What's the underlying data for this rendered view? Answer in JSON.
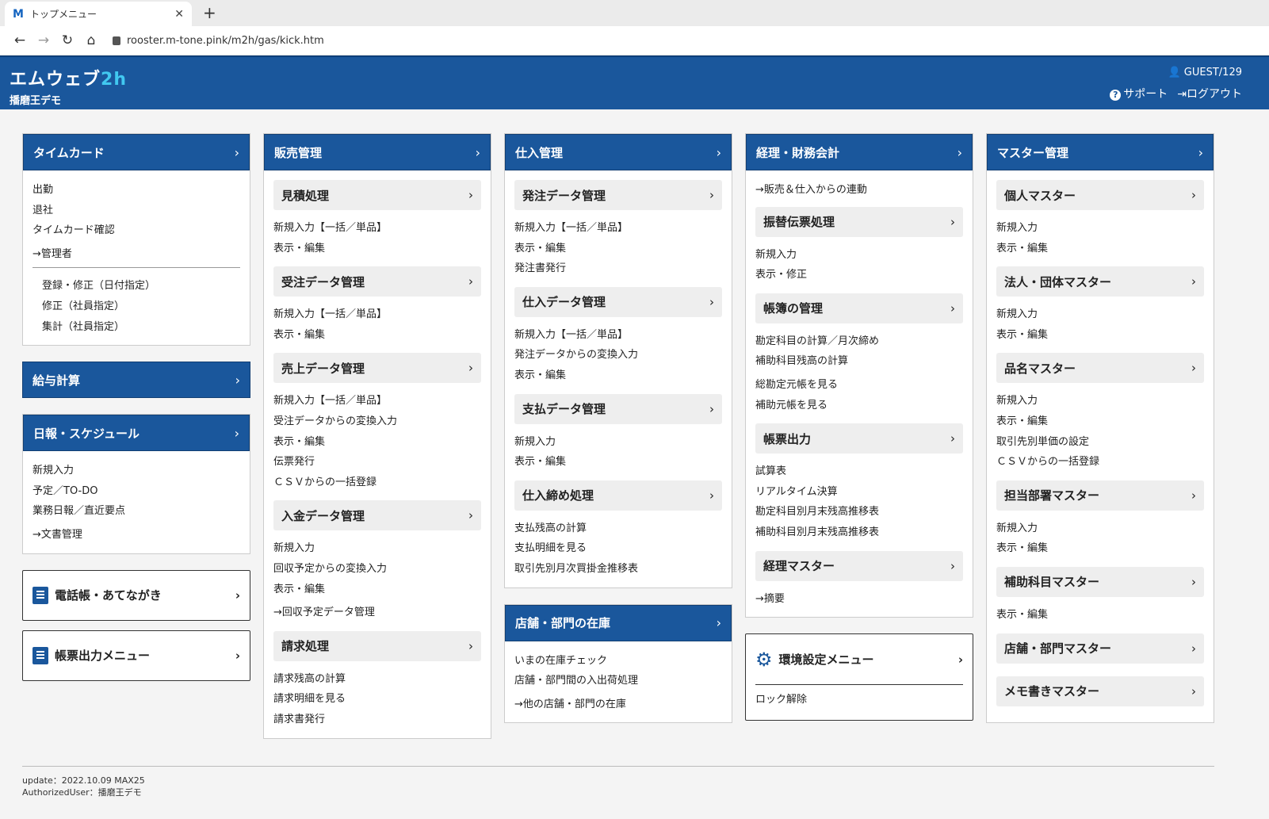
{
  "browser": {
    "tab_title": "トップメニュー",
    "favicon": "M",
    "url": "rooster.m-tone.pink/m2h/gas/kick.htm"
  },
  "header": {
    "brand_main": "エムウェブ",
    "brand_accent": "2h",
    "brand_sub": "播磨王デモ",
    "user": "GUEST/129",
    "support": "サポート",
    "logout": "ログアウト"
  },
  "timecard": {
    "title": "タイムカード",
    "items": [
      "出勤",
      "退社",
      "タイムカード確認"
    ],
    "admin": "→管理者",
    "admin_items": [
      "登録・修正（日付指定）",
      "修正（社員指定）",
      "集計（社員指定）"
    ]
  },
  "payroll": {
    "title": "給与計算"
  },
  "schedule": {
    "title": "日報・スケジュール",
    "items": [
      "新規入力",
      "予定／TO-DO",
      "業務日報／直近要点"
    ],
    "docs": "→文書管理"
  },
  "phonebook": {
    "title": "電話帳・あてながき"
  },
  "forms_menu": {
    "title": "帳票出力メニュー"
  },
  "sales": {
    "title": "販売管理",
    "estimate": {
      "title": "見積処理",
      "items": [
        "新規入力【一括／単品】",
        "表示・編集"
      ]
    },
    "orders": {
      "title": "受注データ管理",
      "items": [
        "新規入力【一括／単品】",
        "表示・編集"
      ]
    },
    "sales_data": {
      "title": "売上データ管理",
      "items": [
        "新規入力【一括／単品】",
        "受注データからの変換入力",
        "表示・編集",
        "伝票発行",
        "ＣＳＶからの一括登録"
      ]
    },
    "payment_in": {
      "title": "入金データ管理",
      "items": [
        "新規入力",
        "回収予定からの変換入力",
        "表示・編集"
      ],
      "link": "→回収予定データ管理"
    },
    "billing": {
      "title": "請求処理",
      "items": [
        "請求残高の計算",
        "請求明細を見る",
        "請求書発行"
      ]
    }
  },
  "purchase": {
    "title": "仕入管理",
    "order_data": {
      "title": "発注データ管理",
      "items": [
        "新規入力【一括／単品】",
        "表示・編集",
        "発注書発行"
      ]
    },
    "purchase_data": {
      "title": "仕入データ管理",
      "items": [
        "新規入力【一括／単品】",
        "発注データからの変換入力",
        "表示・編集"
      ]
    },
    "payment_data": {
      "title": "支払データ管理",
      "items": [
        "新規入力",
        "表示・編集"
      ]
    },
    "closing": {
      "title": "仕入締め処理",
      "items": [
        "支払残高の計算",
        "支払明細を見る",
        "取引先別月次買掛金推移表"
      ]
    }
  },
  "inventory": {
    "title": "店舗・部門の在庫",
    "items": [
      "いまの在庫チェック",
      "店舗・部門間の入出荷処理"
    ],
    "link": "→他の店舗・部門の在庫"
  },
  "accounting": {
    "title": "経理・財務会計",
    "link_top": "→販売＆仕入からの連動",
    "transfer": {
      "title": "振替伝票処理",
      "items": [
        "新規入力",
        "表示・修正"
      ]
    },
    "books": {
      "title": "帳簿の管理",
      "items": [
        "勘定科目の計算／月次締め",
        "補助科目残高の計算"
      ],
      "items2": [
        "総勘定元帳を見る",
        "補助元帳を見る"
      ]
    },
    "reports": {
      "title": "帳票出力",
      "items": [
        "試算表",
        "リアルタイム決算",
        "勘定科目別月末残高推移表",
        "補助科目別月末残高推移表"
      ]
    },
    "master": {
      "title": "経理マスター",
      "link": "→摘要"
    }
  },
  "env": {
    "title": "環境設定メニュー",
    "items": [
      "ロック解除"
    ]
  },
  "master": {
    "title": "マスター管理",
    "personal": {
      "title": "個人マスター",
      "items": [
        "新規入力",
        "表示・編集"
      ]
    },
    "corporate": {
      "title": "法人・団体マスター",
      "items": [
        "新規入力",
        "表示・編集"
      ]
    },
    "product": {
      "title": "品名マスター",
      "items": [
        "新規入力",
        "表示・編集",
        "取引先別単価の設定",
        "ＣＳＶからの一括登録"
      ]
    },
    "dept": {
      "title": "担当部署マスター",
      "items": [
        "新規入力",
        "表示・編集"
      ]
    },
    "subaccount": {
      "title": "補助科目マスター",
      "items": [
        "表示・編集"
      ]
    },
    "store": {
      "title": "店舗・部門マスター"
    },
    "memo": {
      "title": "メモ書きマスター"
    }
  },
  "footer": {
    "update": "update：2022.10.09 MAX25",
    "user": "AuthorizedUser：播磨王デモ"
  }
}
